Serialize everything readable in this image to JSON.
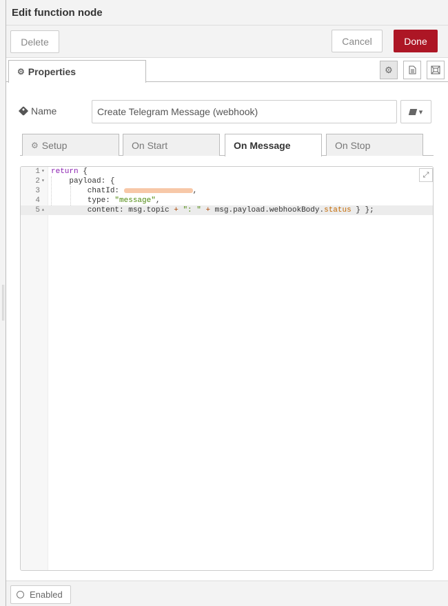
{
  "dialog": {
    "title": "Edit function node"
  },
  "toolbar": {
    "delete_label": "Delete",
    "cancel_label": "Cancel",
    "done_label": "Done",
    "done_color": "#ad1625"
  },
  "tabs": {
    "properties_label": "Properties"
  },
  "name_field": {
    "label": "Name",
    "value": "Create Telegram Message (webhook)"
  },
  "code_tabs": [
    {
      "label": "Setup"
    },
    {
      "label": "On Start"
    },
    {
      "label": "On Message"
    },
    {
      "label": "On Stop"
    }
  ],
  "editor": {
    "line_numbers": [
      "1",
      "2",
      "3",
      "4",
      "5"
    ],
    "tokens": {
      "l1_kw": "return",
      "l1_rest": " {",
      "l2": "    payload: {",
      "l3_key": "        chatId: ",
      "l3_end": ",",
      "l4_key": "        type: ",
      "l4_str": "\"message\"",
      "l4_end": ",",
      "l5_a": "        content: msg.topic ",
      "l5_op1": "+",
      "l5_str": " \": \" ",
      "l5_op2": "+",
      "l5_b": " msg.payload.webhookBody.",
      "l5_prop": "status",
      "l5_end": " } };"
    }
  },
  "footer": {
    "enabled_label": "Enabled"
  }
}
